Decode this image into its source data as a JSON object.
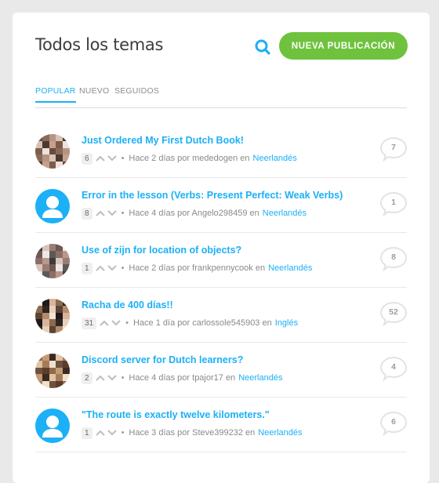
{
  "header": {
    "title": "Todos los temas",
    "new_post_label": "NUEVA PUBLICACIÓN",
    "search_icon": "search-icon"
  },
  "tabs": [
    {
      "label": "POPULAR",
      "active": true
    },
    {
      "label": "NUEVO",
      "active": false
    },
    {
      "label": "SEGUIDOS",
      "active": false
    }
  ],
  "colors": {
    "accent": "#1cb0f6",
    "button": "#6fc23d"
  },
  "posts": [
    {
      "title": "Just Ordered My First Dutch Book!",
      "votes": "6",
      "meta": "Hace 2 días por mededogen en",
      "language": "Neerlandés",
      "comments": "7",
      "avatar": "photo"
    },
    {
      "title": "Error in the lesson (Verbs: Present Perfect: Weak Verbs)",
      "votes": "8",
      "meta": "Hace 4 días por Angelo298459 en",
      "language": "Neerlandés",
      "comments": "1",
      "avatar": "default"
    },
    {
      "title": "Use of zijn for location of objects?",
      "votes": "1",
      "meta": "Hace 2 días por frankpennycook en",
      "language": "Neerlandés",
      "comments": "8",
      "avatar": "photo"
    },
    {
      "title": "Racha de 400 días!!",
      "votes": "31",
      "meta": "Hace 1 día por carlossole545903 en",
      "language": "Inglés",
      "comments": "52",
      "avatar": "photo"
    },
    {
      "title": "Discord server for Dutch learners?",
      "votes": "2",
      "meta": "Hace 4 días por tpajor17 en",
      "language": "Neerlandés",
      "comments": "4",
      "avatar": "photo"
    },
    {
      "title": "\"The route is exactly twelve kilometers.\"",
      "votes": "1",
      "meta": "Hace 3 días por Steve399232 en",
      "language": "Neerlandés",
      "comments": "6",
      "avatar": "default"
    }
  ]
}
